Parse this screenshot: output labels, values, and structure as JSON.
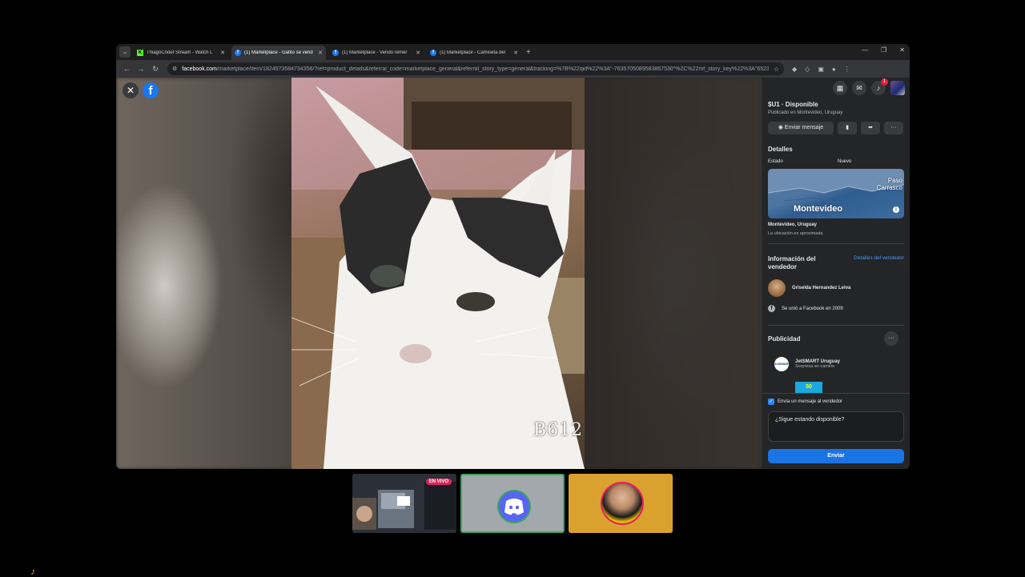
{
  "browser": {
    "tabs": [
      {
        "label": "ThiagoCndef Stream - Watch L",
        "favicon": "kick",
        "active": false
      },
      {
        "label": "(1) Marketplace - Gatito se vend",
        "favicon": "facebook",
        "active": true
      },
      {
        "label": "(1) Marketplace - Vendo remer",
        "favicon": "facebook",
        "active": false
      },
      {
        "label": "(1) Marketplace - Camiseta del",
        "favicon": "facebook",
        "active": false
      }
    ],
    "new_tab_label": "+",
    "url_domain": "facebook.com",
    "url_rest": "/marketplace/item/1824573584734356/?ref=product_details&referral_code=marketplace_general&referral_story_type=general&tracking=%7B%22qid%22%3A\"-7635705089583867530\"%2C%22mf_story_key%22%3A\"652323774513"
  },
  "viewer": {
    "watermark": "B612"
  },
  "listing": {
    "price_status": "$U1 · Disponible",
    "published": "Publicado en Montevideo, Uruguay",
    "send_message_button": "Enviar mensaje",
    "details_title": "Detalles",
    "condition_label": "Estado",
    "condition_value": "Nuevo",
    "map_city": "Montevideo",
    "map_area": "Paso\nCarrasco",
    "location": "Montevideo, Uruguay",
    "location_note": "La ubicación es aproximada",
    "seller_title": "Información del vendedor",
    "seller_details_link": "Detalles del vendedor",
    "seller_name": "Griselda Hernandez Leiva",
    "seller_joined": "Se unió a Facebook en 2009",
    "ads_title": "Publicidad",
    "ad_name": "JetSMART Uruguay",
    "ad_sub": "Sorpresa en camino",
    "ad_thumb": "50",
    "send_checkbox_label": "Envía un mensaje al vendedor",
    "message_text": "¿Sigue estando disponible?",
    "send_button": "Enviar"
  },
  "notifications_badge": "1",
  "overlay": {
    "live_badge": "EN VIVO"
  },
  "colors": {
    "facebook_blue": "#1877f2",
    "send_button": "#1b74e4",
    "discord": "#5865f2",
    "live_red": "#e0245e"
  }
}
